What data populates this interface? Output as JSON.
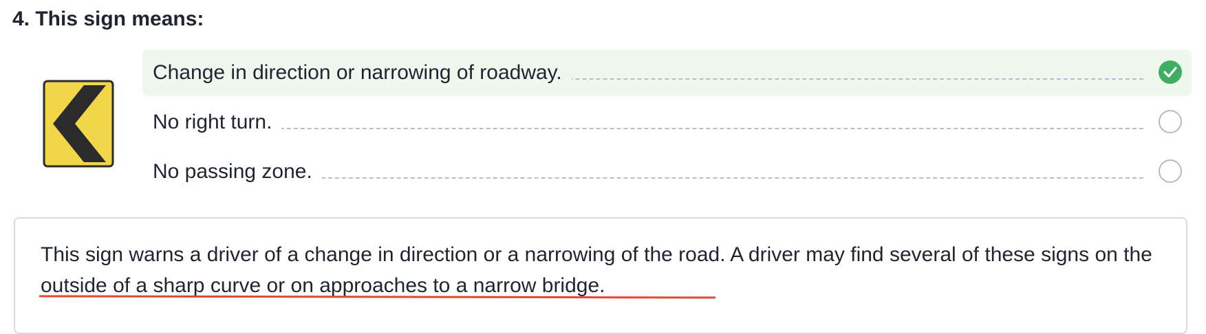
{
  "question": {
    "title": "4. This sign means:"
  },
  "sign": {
    "icon": "chevron-left-warning-sign",
    "fill_color": "#f2d64a",
    "symbol_color": "#2b2b2b"
  },
  "answers": [
    {
      "label": "Change in direction or narrowing of roadway.",
      "selected": true,
      "correct": true
    },
    {
      "label": "No right turn.",
      "selected": false,
      "correct": false
    },
    {
      "label": "No passing zone.",
      "selected": false,
      "correct": false
    }
  ],
  "explanation": {
    "text_part1": "This sign warns a driver of a change in direction or a narrowing of the road. A driver may find several of these signs ",
    "text_part2": "on the outside of a sharp curve or on approaches to a narrow bridge."
  },
  "colors": {
    "correct_background": "#eef8ee",
    "correct_check": "#3fae62",
    "underline": "#e0492c"
  }
}
